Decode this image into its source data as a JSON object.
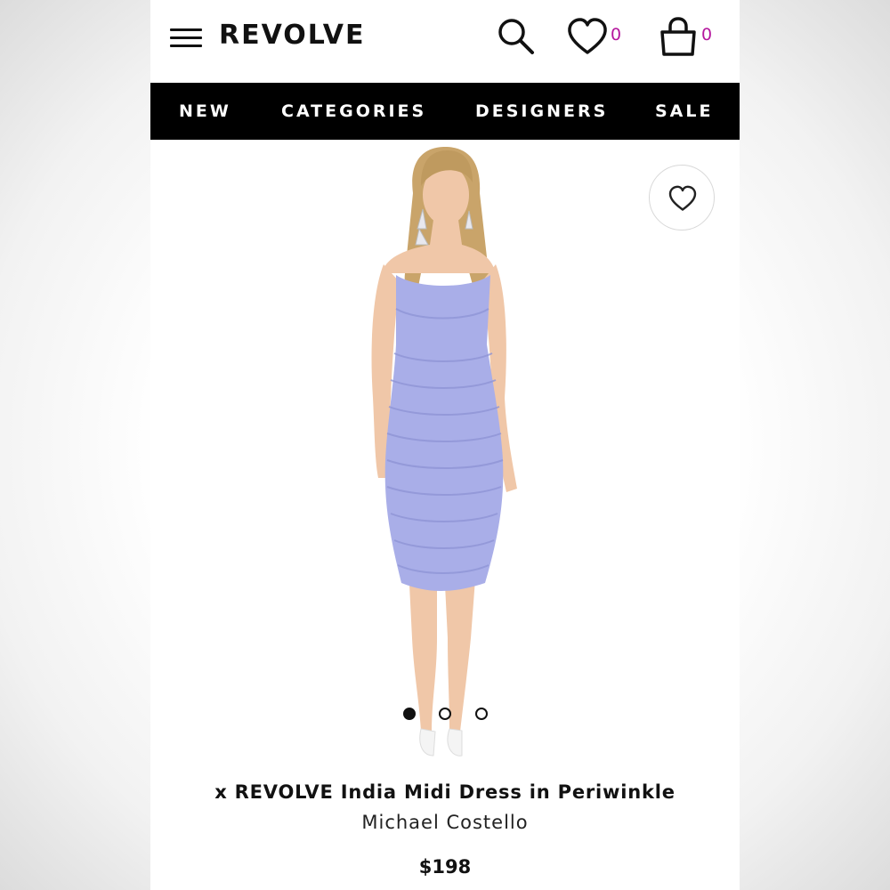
{
  "header": {
    "logo": "REVOLVE",
    "wishlist_count": "0",
    "bag_count": "0"
  },
  "nav": {
    "items": [
      "NEW",
      "CATEGORIES",
      "DESIGNERS",
      "SALE"
    ]
  },
  "product": {
    "title": "x REVOLVE India Midi Dress in Periwinkle",
    "designer": "Michael Costello",
    "price": "$198",
    "dress_color": "#a9aee8",
    "skin_color": "#f0c7a8",
    "hair_color": "#c9a46a"
  },
  "gallery": {
    "total_images": 3,
    "active_index": 0
  },
  "icons": {
    "menu": "hamburger-menu-icon",
    "search": "search-icon",
    "wishlist": "heart-icon",
    "bag": "shopping-bag-icon",
    "favorite": "heart-outline-icon"
  },
  "colors": {
    "accent": "#b5179e",
    "nav_bg": "#000000",
    "text": "#111111"
  }
}
